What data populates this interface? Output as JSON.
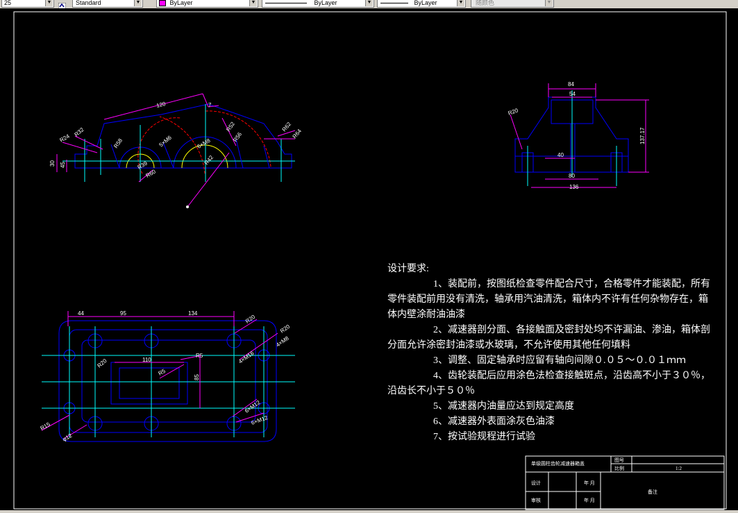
{
  "toolbar": {
    "linetype_scale": "25",
    "text_style": "Standard",
    "layer_color": "ByLayer",
    "linetype": "ByLayer",
    "lineweight": "ByLayer",
    "plot_style": "随颜色",
    "color_swatch": "#ff00ff",
    "accent": "#000080",
    "button_face": "#d4d0c8"
  },
  "drawing": {
    "front_view_dims": [
      "120",
      "7",
      "R24",
      "R32",
      "R58",
      "R39",
      "5×M6",
      "5×M8",
      "R42",
      "R50",
      "R52",
      "R62",
      "R56",
      "R64",
      "R90",
      "45",
      "30",
      "R52",
      "R60"
    ],
    "side_view_dims": [
      "84",
      "54",
      "40",
      "80",
      "136",
      "R20",
      "137.17"
    ],
    "top_view_dims": [
      "44",
      "95",
      "134",
      "110",
      "R5",
      "R5",
      "R20",
      "85",
      "4×M16",
      "4×M8",
      "R20",
      "6×M12",
      "6×M12",
      "φ12",
      "R15"
    ],
    "colors": {
      "outline": "#0000ff",
      "dimension": "#ff00ff",
      "centerline": "#00ffff",
      "hidden": "#ffff00",
      "text": "#ffffff",
      "pitch_arc": "#ff0000",
      "border": "#ffffff"
    }
  },
  "notes": {
    "title": "设计要求:",
    "items": [
      "1、装配前，按图纸检查零件配合尺寸，合格零件才能装配，所有零件装配前用没有清洗，轴承用汽油清洗，箱体内不许有任何杂物存在，箱体内壁涂耐油油漆",
      "2、减速器剖分面、各接触面及密封处均不许漏油、渗油，箱体剖分面允许涂密封油漆或水玻璃，不允许使用其他任何填料",
      "3、调整、固定轴承时应留有轴向间隙０.０５～０.０１ｍｍ",
      "4、齿轮装配后应用涂色法检查接触斑点，沿齿高不小于３０％，沿齿长不小于５０％",
      "5、减速器内油量应达到规定高度",
      "6、减速器外表面涂灰色油漆",
      "7、按试验规程进行试验"
    ]
  },
  "title_block": {
    "name": "单级圆柱齿轮减速器箱盖",
    "drawing_no_label": "图号",
    "scale_label": "比例",
    "scale_value": "1:2",
    "designer_label": "设计",
    "reviewer_label": "审核",
    "date1": "年 月",
    "date2": "年 月",
    "material_label": "备注"
  }
}
